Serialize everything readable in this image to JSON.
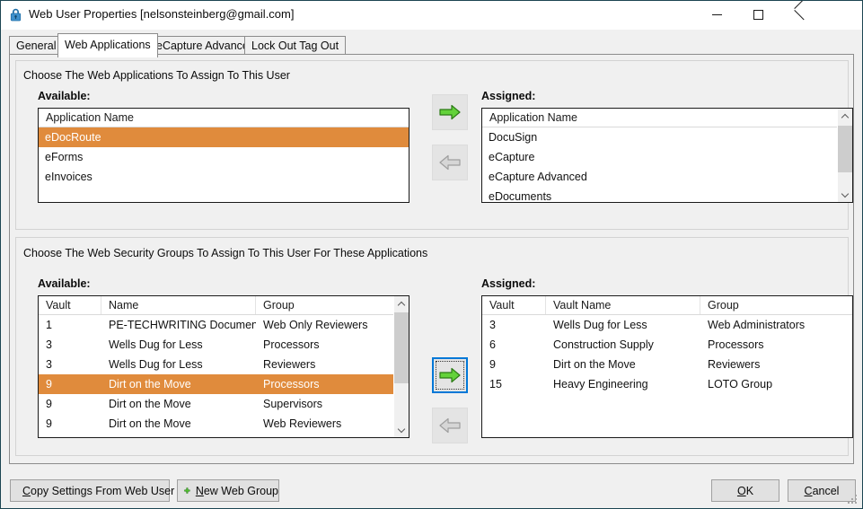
{
  "window": {
    "title": "Web User Properties [nelsonsteinberg@gmail.com]",
    "lock_icon": "lock-icon",
    "minimize_label": "Minimize",
    "maximize_label": "Maximize",
    "close_label": "Close"
  },
  "tabs": [
    {
      "label": "General",
      "active": false
    },
    {
      "label": "Web Applications",
      "active": true
    },
    {
      "label": "eCapture Advanced",
      "active": false
    },
    {
      "label": "Lock Out Tag Out",
      "active": false
    }
  ],
  "applications_group": {
    "title": "Choose The Web Applications To Assign To This User",
    "available_label": "Available:",
    "assigned_label": "Assigned:",
    "available": {
      "header": "Application Name",
      "rows": [
        {
          "name": "eDocRoute",
          "selected": true
        },
        {
          "name": "eForms",
          "selected": false
        },
        {
          "name": "eInvoices",
          "selected": false
        }
      ]
    },
    "assigned": {
      "header": "Application Name",
      "rows": [
        {
          "name": "DocuSign",
          "selected": false
        },
        {
          "name": "eCapture",
          "selected": false
        },
        {
          "name": "eCapture Advanced",
          "selected": false
        },
        {
          "name": "eDocuments",
          "selected": false
        }
      ]
    },
    "assign_button": "assign-application-button",
    "unassign_button": "unassign-application-button"
  },
  "security_groups_group": {
    "title": "Choose The Web Security Groups To Assign To This User For These Applications",
    "available_label": "Available:",
    "assigned_label": "Assigned:",
    "available": {
      "columns": [
        "Vault",
        "Name",
        "Group"
      ],
      "rows": [
        {
          "vault": "1",
          "name": "PE-TECHWRITING Documents",
          "group": "Web Only Reviewers",
          "selected": false
        },
        {
          "vault": "3",
          "name": "Wells Dug for Less",
          "group": "Processors",
          "selected": false
        },
        {
          "vault": "3",
          "name": "Wells Dug for Less",
          "group": "Reviewers",
          "selected": false
        },
        {
          "vault": "9",
          "name": "Dirt on the Move",
          "group": "Processors",
          "selected": true
        },
        {
          "vault": "9",
          "name": "Dirt on the Move",
          "group": "Supervisors",
          "selected": false
        },
        {
          "vault": "9",
          "name": "Dirt on the Move",
          "group": "Web Reviewers",
          "selected": false
        }
      ]
    },
    "assigned": {
      "columns": [
        "Vault",
        "Vault Name",
        "Group"
      ],
      "rows": [
        {
          "vault": "3",
          "name": "Wells Dug for Less",
          "group": "Web Administrators",
          "selected": false
        },
        {
          "vault": "6",
          "name": "Construction Supply",
          "group": "Processors",
          "selected": false
        },
        {
          "vault": "9",
          "name": "Dirt on the Move",
          "group": "Reviewers",
          "selected": false
        },
        {
          "vault": "15",
          "name": "Heavy Engineering",
          "group": "LOTO Group",
          "selected": false
        }
      ]
    },
    "assign_button": "assign-security-group-button",
    "unassign_button": "unassign-security-group-button"
  },
  "footer": {
    "copy_settings": {
      "label": "Copy Settings From Web User",
      "accel": "C",
      "icon": "copy-pages-icon"
    },
    "new_web_group": {
      "label": "New Web Group",
      "accel": "N",
      "icon": "plus-icon"
    },
    "ok": {
      "label": "OK",
      "accel": "O"
    },
    "cancel": {
      "label": "Cancel",
      "accel": "C"
    }
  },
  "colors": {
    "selection": "#e08b3c",
    "focus": "#0078d7",
    "window_border": "#1c4552",
    "dialog_bg": "#f0f0f0"
  }
}
